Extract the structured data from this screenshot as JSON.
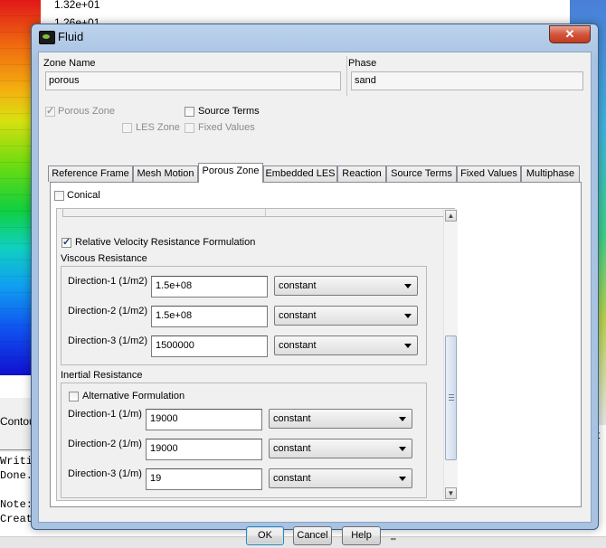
{
  "background": {
    "legend_values": [
      "1.32e+01",
      "1.26e+01"
    ],
    "contours_label": "Contou",
    "right_fragment": "t",
    "console_lines": [
      "Writi",
      "Done.",
      "Note:",
      "Creat"
    ],
    "bottom_fragment": "'''"
  },
  "window": {
    "title": "Fluid",
    "close_glyph": "✕",
    "zone_name_label": "Zone Name",
    "zone_name_value": "porous",
    "phase_label": "Phase",
    "phase_value": "sand",
    "porous_zone_label": "Porous Zone",
    "les_zone_label": "LES Zone",
    "source_terms_label": "Source Terms",
    "fixed_values_label": "Fixed Values",
    "tabs": [
      {
        "label": "Reference Frame",
        "active": false
      },
      {
        "label": "Mesh Motion",
        "active": false
      },
      {
        "label": "Porous Zone",
        "active": true
      },
      {
        "label": "Embedded LES",
        "active": false
      },
      {
        "label": "Reaction",
        "active": false
      },
      {
        "label": "Source Terms",
        "active": false
      },
      {
        "label": "Fixed Values",
        "active": false
      },
      {
        "label": "Multiphase",
        "active": false
      }
    ],
    "conical_label": "Conical",
    "relative_velocity_label": "Relative Velocity Resistance Formulation",
    "viscous_resistance_label": "Viscous Resistance",
    "viscous": [
      {
        "label": "Direction-1 (1/m2)",
        "value": "1.5e+08",
        "method": "constant"
      },
      {
        "label": "Direction-2 (1/m2)",
        "value": "1.5e+08",
        "method": "constant"
      },
      {
        "label": "Direction-3 (1/m2)",
        "value": "1500000",
        "method": "constant"
      }
    ],
    "inertial_resistance_label": "Inertial Resistance",
    "alternative_formulation_label": "Alternative Formulation",
    "inertial": [
      {
        "label": "Direction-1 (1/m)",
        "value": "19000",
        "method": "constant"
      },
      {
        "label": "Direction-2 (1/m)",
        "value": "19000",
        "method": "constant"
      },
      {
        "label": "Direction-3 (1/m)",
        "value": "19",
        "method": "constant"
      }
    ],
    "buttons": {
      "ok": "OK",
      "cancel": "Cancel",
      "help": "Help"
    }
  }
}
